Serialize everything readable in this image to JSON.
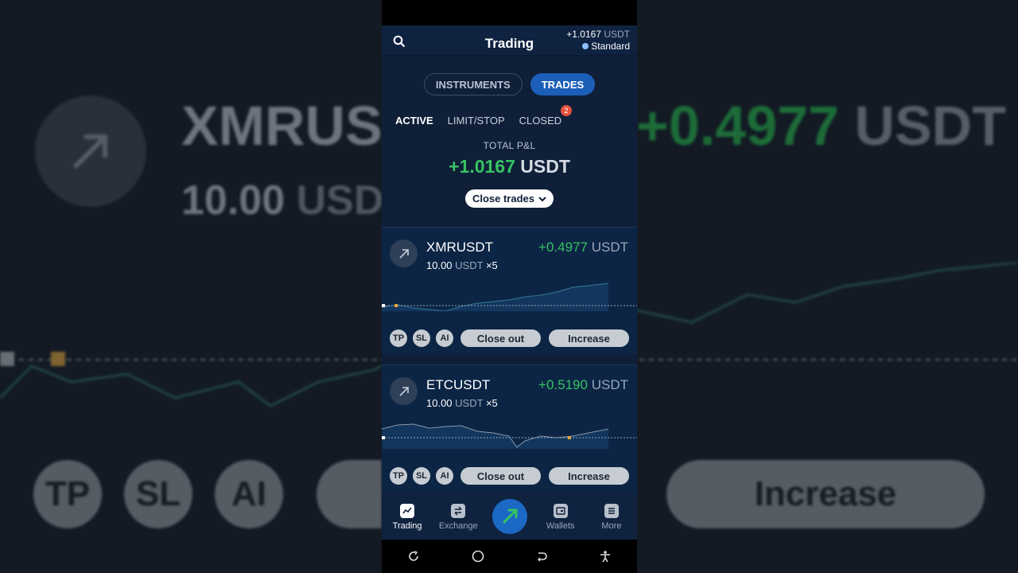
{
  "backdrop": {
    "symbol": "XMRUSDT",
    "amount": "10.00",
    "amount_unit": "USDT",
    "pnl": "+0.4977",
    "pnl_unit": "USDT",
    "tp": "TP",
    "sl": "SL",
    "ai": "AI",
    "increase": "Increase"
  },
  "header": {
    "title": "Trading",
    "balance_value": "+1.0167",
    "balance_unit": "USDT",
    "account_type": "Standard"
  },
  "segments": {
    "instruments": "INSTRUMENTS",
    "trades": "TRADES",
    "selected": "TRADES"
  },
  "subtabs": {
    "active": "ACTIVE",
    "limit_stop": "LIMIT/STOP",
    "closed": "CLOSED",
    "closed_badge": "2"
  },
  "total": {
    "label": "TOTAL P&L",
    "value": "+1.0167",
    "unit": "USDT",
    "close_trades": "Close trades"
  },
  "trades": [
    {
      "symbol": "XMRUSDT",
      "amount": "10.00",
      "unit": "USDT",
      "leverage": "×5",
      "pnl": "+0.4977",
      "pnl_unit": "USDT",
      "tp": "TP",
      "sl": "SL",
      "ai": "AI",
      "close_out": "Close out",
      "increase": "Increase"
    },
    {
      "symbol": "ETCUSDT",
      "amount": "10.00",
      "unit": "USDT",
      "leverage": "×5",
      "pnl": "+0.5190",
      "pnl_unit": "USDT",
      "tp": "TP",
      "sl": "SL",
      "ai": "AI",
      "close_out": "Close out",
      "increase": "Increase"
    }
  ],
  "tabbar": {
    "trading": "Trading",
    "exchange": "Exchange",
    "wallets": "Wallets",
    "more": "More"
  },
  "colors": {
    "accent": "#1b5fb8",
    "positive": "#37c263",
    "badge": "#e5533f",
    "background": "#0f1f38"
  }
}
